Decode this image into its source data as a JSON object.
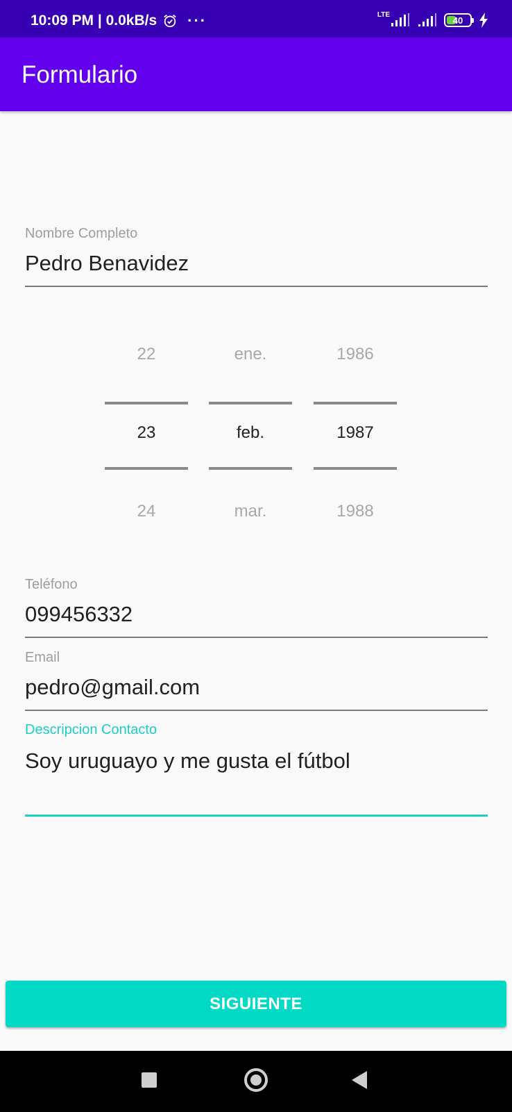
{
  "status_bar": {
    "time_speed": "10:09 PM | 0.0kB/s",
    "more": "···",
    "network_type": "LTE",
    "battery_level": "40",
    "battery_fraction": 0.4
  },
  "app_bar": {
    "title": "Formulario"
  },
  "form": {
    "nombre": {
      "label": "Nombre Completo",
      "value": "Pedro Benavidez"
    },
    "date_picker": {
      "day": {
        "prev": "22",
        "selected": "23",
        "next": "24"
      },
      "month": {
        "prev": "ene.",
        "selected": "feb.",
        "next": "mar."
      },
      "year": {
        "prev": "1986",
        "selected": "1987",
        "next": "1988"
      }
    },
    "telefono": {
      "label": "Teléfono",
      "value": "099456332"
    },
    "email": {
      "label": "Email",
      "value": "pedro@gmail.com"
    },
    "descripcion": {
      "label": "Descripcion Contacto",
      "value": "Soy uruguayo y me gusta el fútbol"
    }
  },
  "siguiente_label": "SIGUIENTE",
  "colors": {
    "status_bar": "#3700b3",
    "app_bar": "#6200ee",
    "accent": "#03dac5",
    "background": "#fafafa"
  }
}
